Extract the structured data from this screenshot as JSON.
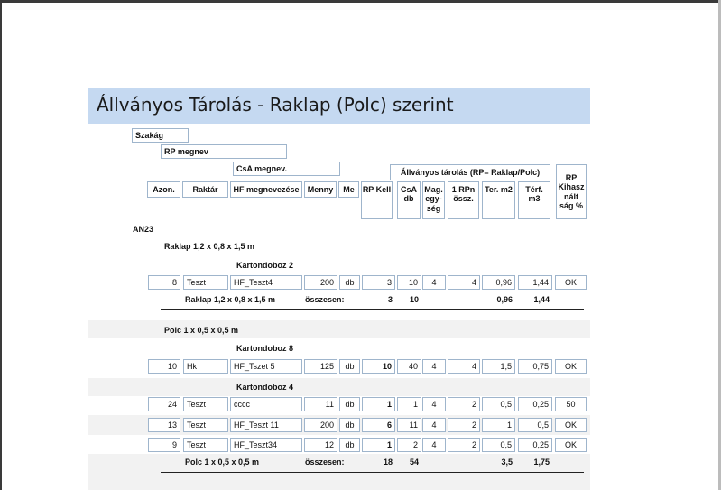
{
  "report": {
    "title": "Állványos Tárolás - Raklap (Polc) szerint",
    "labels": {
      "szakag": "Szakág",
      "rp_megnev": "RP megnev",
      "csa_megnev": "CsA megnev.",
      "group_header": "Állványos tárolás (RP= Raklap/Polc)"
    },
    "columns": {
      "azon": "Azon.",
      "raktar": "Raktár",
      "hf": "HF megnevezése",
      "menny": "Menny",
      "me": "Me",
      "rpkell": "RP Kell",
      "csa_db": "CsA db",
      "mag": "Mag. egy-ség",
      "rpn": "1 RPn össz.",
      "ter": "Ter. m2",
      "terf": "Térf. m3",
      "rpkih": "RP Kihasz nált ság %"
    },
    "szakag_value": "AN23",
    "sections": [
      {
        "rp": "Raklap 1,2 x 0,8 x 1,5 m",
        "groups": [
          {
            "csa": "Kartondoboz 2",
            "rows": [
              {
                "azon": "8",
                "raktar": "Teszt",
                "hf": "HF_Teszt4",
                "menny": "200",
                "me": "db",
                "rpkell": "3",
                "csadb": "10",
                "mag": "4",
                "rpn": "4",
                "ter": "0,96",
                "terf": "1,44",
                "kih": "OK"
              }
            ]
          }
        ],
        "summary": {
          "rp": "Raklap 1,2 x 0,8 x 1,5 m",
          "label": "összesen:",
          "rpkell": "3",
          "csadb": "10",
          "ter": "0,96",
          "terf": "1,44"
        }
      },
      {
        "rp": "Polc 1 x 0,5 x 0,5 m",
        "groups": [
          {
            "csa": "Kartondoboz 8",
            "rows": [
              {
                "azon": "10",
                "raktar": "Hk",
                "hf": "HF_Tszet 5",
                "menny": "125",
                "me": "db",
                "rpkell": "10",
                "csadb": "40",
                "mag": "4",
                "rpn": "4",
                "ter": "1,5",
                "terf": "0,75",
                "kih": "OK"
              }
            ]
          },
          {
            "csa": "Kartondoboz 4",
            "rows": [
              {
                "azon": "24",
                "raktar": "Teszt",
                "hf": "cccc",
                "menny": "11",
                "me": "db",
                "rpkell": "1",
                "csadb": "1",
                "mag": "4",
                "rpn": "2",
                "ter": "0,5",
                "terf": "0,25",
                "kih": "50"
              },
              {
                "azon": "13",
                "raktar": "Teszt",
                "hf": "HF_Teszt 11",
                "menny": "200",
                "me": "db",
                "rpkell": "6",
                "csadb": "11",
                "mag": "4",
                "rpn": "2",
                "ter": "1",
                "terf": "0,5",
                "kih": "OK"
              },
              {
                "azon": "9",
                "raktar": "Teszt",
                "hf": "HF_Teszt34",
                "menny": "12",
                "me": "db",
                "rpkell": "1",
                "csadb": "2",
                "mag": "4",
                "rpn": "2",
                "ter": "0,5",
                "terf": "0,25",
                "kih": "OK"
              }
            ]
          }
        ],
        "summary": {
          "rp": "Polc 1 x 0,5 x 0,5 m",
          "label": "összesen:",
          "rpkell": "18",
          "csadb": "54",
          "ter": "3,5",
          "terf": "1,75"
        }
      }
    ]
  },
  "colors": {
    "title_band": "#c5d9f1",
    "cell_border": "#9fb5cc",
    "alt_row": "#f2f2f2"
  }
}
